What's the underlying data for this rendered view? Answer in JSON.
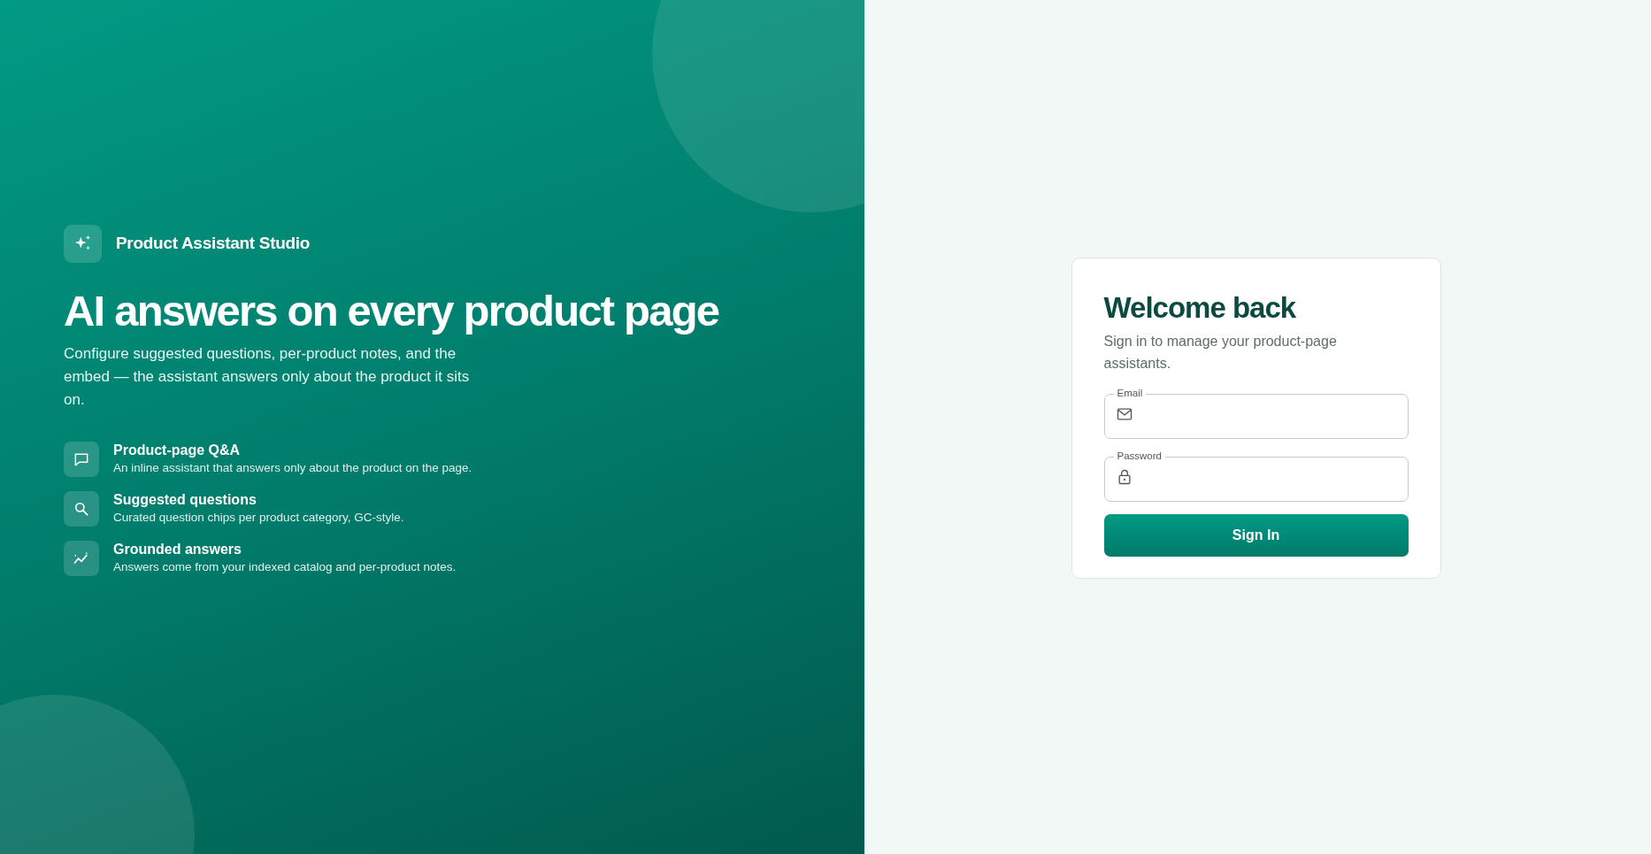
{
  "brand": {
    "name": "Product Assistant Studio"
  },
  "hero": {
    "title": "AI answers on every product page",
    "description": "Configure suggested questions, per-product notes, and the embed — the assistant answers only about the product it sits on."
  },
  "features": [
    {
      "kind": "chat",
      "title": "Product-page Q&A",
      "description": "An inline assistant that answers only about the product on the page."
    },
    {
      "kind": "search",
      "title": "Suggested questions",
      "description": "Curated question chips per product category, GC-style."
    },
    {
      "kind": "trend",
      "title": "Grounded answers",
      "description": "Answers come from your indexed catalog and per-product notes."
    }
  ],
  "login": {
    "title": "Welcome back",
    "subtitle": "Sign in to manage your product-page assistants.",
    "fields": [
      {
        "kind": "email",
        "label": "Email"
      },
      {
        "kind": "password",
        "label": "Password"
      }
    ],
    "button": "Sign In"
  }
}
